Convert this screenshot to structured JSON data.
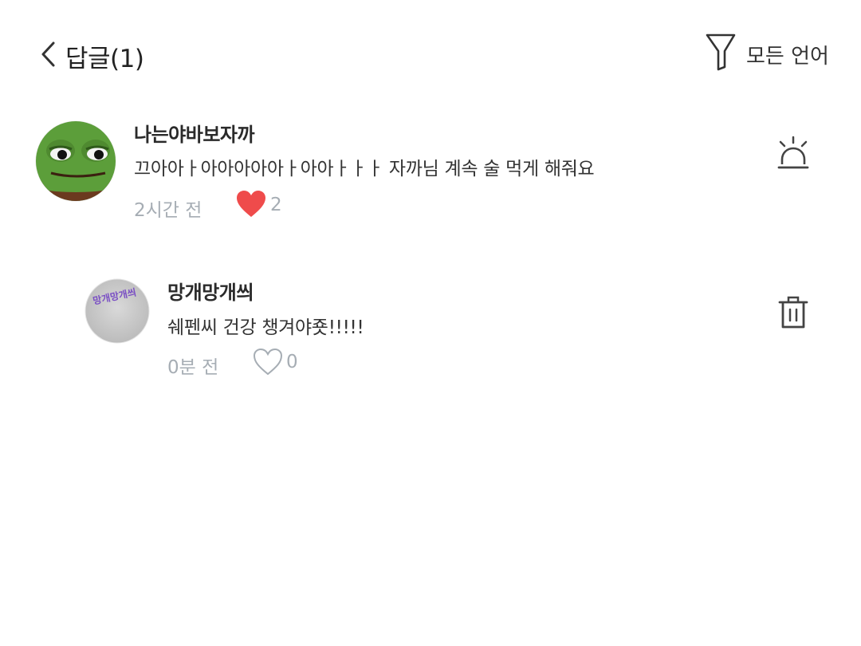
{
  "header": {
    "title": "답글(1)",
    "filter_label": "모든 언어"
  },
  "comment": {
    "author": "나는야바보자까",
    "text": "끄아아ㅏ아아아아아ㅏ아아ㅏㅏㅏ 자까님 계속 술 먹게 해줘요",
    "time": "2시간 전",
    "likes": "2",
    "liked": true
  },
  "reply": {
    "author": "망개망개씌",
    "text": "쉐펜씨 건강 챙겨야죳!!!!!",
    "time": "0분 전",
    "likes": "0",
    "liked": false,
    "avatar_sticker_text": "망개망개씌"
  },
  "colors": {
    "heart_active": "#ef4b4b",
    "meta": "#a6adb4",
    "icon": "#444444"
  }
}
